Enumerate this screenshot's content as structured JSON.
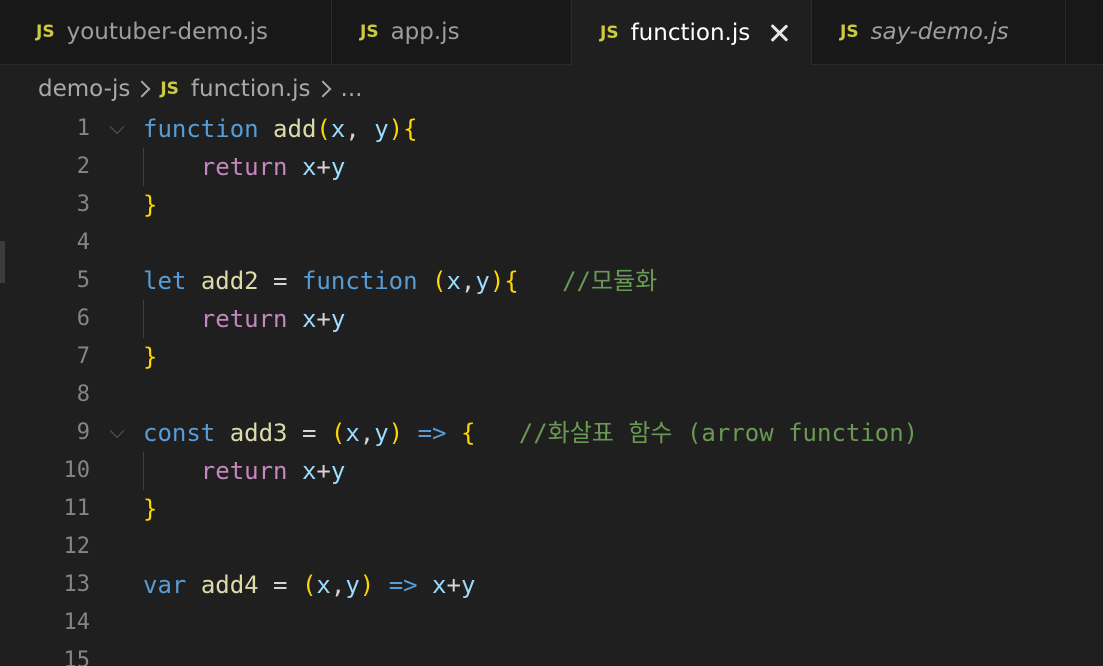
{
  "tabs": [
    {
      "badge": "JS",
      "label": "youtuber-demo.js",
      "active": false,
      "italic": false
    },
    {
      "badge": "JS",
      "label": "app.js",
      "active": false,
      "italic": false
    },
    {
      "badge": "JS",
      "label": "function.js",
      "active": true,
      "italic": false
    },
    {
      "badge": "JS",
      "label": "say-demo.js",
      "active": false,
      "italic": true
    }
  ],
  "breadcrumb": {
    "folder": "demo-js",
    "file_badge": "JS",
    "file": "function.js",
    "ellipsis": "..."
  },
  "colors": {
    "keyword": "#569cd6",
    "function_name": "#dcdcaa",
    "bracket": "#ffd700",
    "parameter": "#9cdcfe",
    "control": "#c586c0",
    "comment": "#6a9955",
    "js_badge": "#cbcb41"
  },
  "editor": {
    "lines": [
      {
        "n": "1",
        "fold": true,
        "guide": false,
        "tokens": [
          {
            "t": "function",
            "c": "t-keyword"
          },
          {
            "t": " ",
            "c": ""
          },
          {
            "t": "add",
            "c": "t-fn"
          },
          {
            "t": "(",
            "c": "t-bracket"
          },
          {
            "t": "x",
            "c": "t-param"
          },
          {
            "t": ", ",
            "c": "t-op"
          },
          {
            "t": "y",
            "c": "t-param"
          },
          {
            "t": ")",
            "c": "t-bracket"
          },
          {
            "t": "{",
            "c": "t-bracket"
          }
        ]
      },
      {
        "n": "2",
        "fold": false,
        "guide": true,
        "tokens": [
          {
            "t": "    ",
            "c": ""
          },
          {
            "t": "return",
            "c": "t-ctrl"
          },
          {
            "t": " ",
            "c": ""
          },
          {
            "t": "x",
            "c": "t-param"
          },
          {
            "t": "+",
            "c": "t-op"
          },
          {
            "t": "y",
            "c": "t-param"
          }
        ]
      },
      {
        "n": "3",
        "fold": false,
        "guide": false,
        "tokens": [
          {
            "t": "}",
            "c": "t-bracket"
          }
        ]
      },
      {
        "n": "4",
        "fold": false,
        "guide": false,
        "tokens": []
      },
      {
        "n": "5",
        "fold": false,
        "guide": false,
        "tokens": [
          {
            "t": "let",
            "c": "t-keyword"
          },
          {
            "t": " ",
            "c": ""
          },
          {
            "t": "add2",
            "c": "t-fn"
          },
          {
            "t": " = ",
            "c": "t-op"
          },
          {
            "t": "function",
            "c": "t-keyword"
          },
          {
            "t": " ",
            "c": ""
          },
          {
            "t": "(",
            "c": "t-bracket"
          },
          {
            "t": "x",
            "c": "t-param"
          },
          {
            "t": ",",
            "c": "t-op"
          },
          {
            "t": "y",
            "c": "t-param"
          },
          {
            "t": ")",
            "c": "t-bracket"
          },
          {
            "t": "{",
            "c": "t-bracket"
          },
          {
            "t": "   ",
            "c": ""
          },
          {
            "t": "//모듈화",
            "c": "t-comment"
          }
        ]
      },
      {
        "n": "6",
        "fold": false,
        "guide": true,
        "tokens": [
          {
            "t": "    ",
            "c": ""
          },
          {
            "t": "return",
            "c": "t-ctrl"
          },
          {
            "t": " ",
            "c": ""
          },
          {
            "t": "x",
            "c": "t-param"
          },
          {
            "t": "+",
            "c": "t-op"
          },
          {
            "t": "y",
            "c": "t-param"
          }
        ]
      },
      {
        "n": "7",
        "fold": false,
        "guide": false,
        "tokens": [
          {
            "t": "}",
            "c": "t-bracket"
          }
        ]
      },
      {
        "n": "8",
        "fold": false,
        "guide": false,
        "tokens": []
      },
      {
        "n": "9",
        "fold": true,
        "guide": false,
        "tokens": [
          {
            "t": "const",
            "c": "t-keyword"
          },
          {
            "t": " ",
            "c": ""
          },
          {
            "t": "add3",
            "c": "t-fn"
          },
          {
            "t": " = ",
            "c": "t-op"
          },
          {
            "t": "(",
            "c": "t-bracket"
          },
          {
            "t": "x",
            "c": "t-param"
          },
          {
            "t": ",",
            "c": "t-op"
          },
          {
            "t": "y",
            "c": "t-param"
          },
          {
            "t": ")",
            "c": "t-bracket"
          },
          {
            "t": " ",
            "c": ""
          },
          {
            "t": "=>",
            "c": "t-keyword"
          },
          {
            "t": " ",
            "c": ""
          },
          {
            "t": "{",
            "c": "t-bracket"
          },
          {
            "t": "   ",
            "c": ""
          },
          {
            "t": "//화살표 함수 (arrow function)",
            "c": "t-comment"
          }
        ]
      },
      {
        "n": "10",
        "fold": false,
        "guide": true,
        "tokens": [
          {
            "t": "    ",
            "c": ""
          },
          {
            "t": "return",
            "c": "t-ctrl"
          },
          {
            "t": " ",
            "c": ""
          },
          {
            "t": "x",
            "c": "t-param"
          },
          {
            "t": "+",
            "c": "t-op"
          },
          {
            "t": "y",
            "c": "t-param"
          }
        ]
      },
      {
        "n": "11",
        "fold": false,
        "guide": false,
        "tokens": [
          {
            "t": "}",
            "c": "t-bracket"
          }
        ]
      },
      {
        "n": "12",
        "fold": false,
        "guide": false,
        "tokens": []
      },
      {
        "n": "13",
        "fold": false,
        "guide": false,
        "tokens": [
          {
            "t": "var",
            "c": "t-keyword"
          },
          {
            "t": " ",
            "c": ""
          },
          {
            "t": "add4",
            "c": "t-fn"
          },
          {
            "t": " = ",
            "c": "t-op"
          },
          {
            "t": "(",
            "c": "t-bracket"
          },
          {
            "t": "x",
            "c": "t-param"
          },
          {
            "t": ",",
            "c": "t-op"
          },
          {
            "t": "y",
            "c": "t-param"
          },
          {
            "t": ")",
            "c": "t-bracket"
          },
          {
            "t": " ",
            "c": ""
          },
          {
            "t": "=>",
            "c": "t-keyword"
          },
          {
            "t": " ",
            "c": ""
          },
          {
            "t": "x",
            "c": "t-param"
          },
          {
            "t": "+",
            "c": "t-op"
          },
          {
            "t": "y",
            "c": "t-param"
          }
        ]
      },
      {
        "n": "14",
        "fold": false,
        "guide": false,
        "tokens": []
      },
      {
        "n": "15",
        "fold": false,
        "guide": false,
        "tokens": []
      }
    ]
  }
}
